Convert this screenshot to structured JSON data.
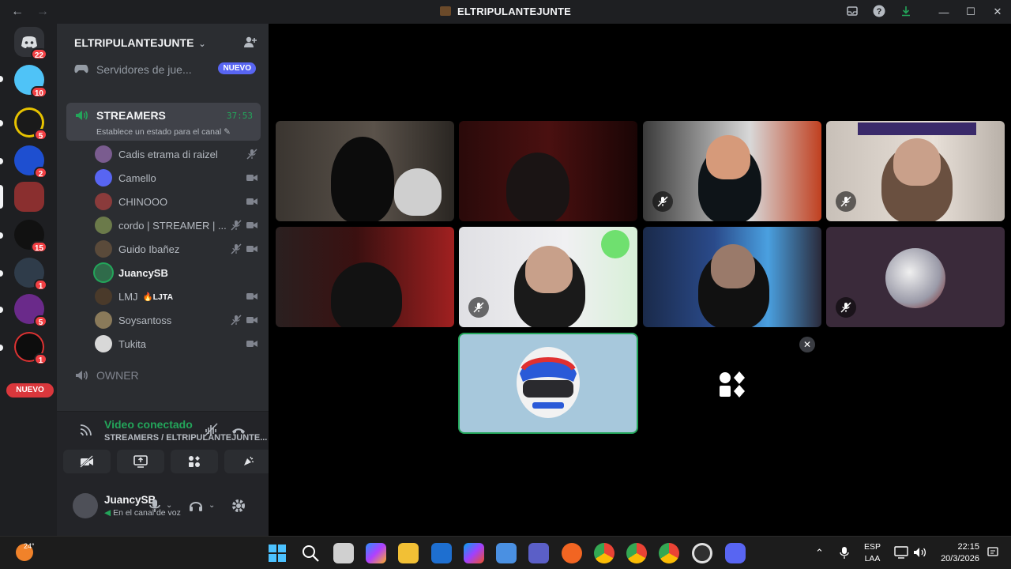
{
  "window": {
    "title": "ELTRIPULANTEJUNTE"
  },
  "rail": {
    "badges": [
      "22",
      "10",
      "5",
      "2",
      "15",
      "1",
      "5",
      "1"
    ],
    "new_label": "NUEVO"
  },
  "sidebar": {
    "server_name": "ELTRIPULANTEJUNTE",
    "games_label": "Servidores de jue...",
    "games_new_tag": "NUEVO",
    "voice_channel": {
      "name": "STREAMERS",
      "timer": "37:53",
      "status": "Establece un estado para el canal"
    },
    "members": [
      {
        "name": "Cadis etrama di raizel",
        "color": "#7a5c8f"
      },
      {
        "name": "Camello",
        "color": "#5865f2"
      },
      {
        "name": "CHINOOO",
        "color": "#8a3b3b"
      },
      {
        "name": "cordo | STREAMER | ...",
        "color": "#6b7a4a"
      },
      {
        "name": "Guido Ibañez",
        "color": "#5a4a3a"
      },
      {
        "name": "JuancySB",
        "color": "#2f6b4a"
      },
      {
        "name": "LMJ",
        "tag": "🔥LJTA",
        "color": "#4a3a2a"
      },
      {
        "name": "Soysantoss",
        "color": "#8a7a5a"
      },
      {
        "name": "Tukita",
        "color": "#d8d8d8"
      }
    ],
    "owner_channel": "OWNER",
    "rtc": {
      "status": "Video conectado",
      "channel": "STREAMERS / ELTRIPULANTEJUNTE..."
    },
    "user": {
      "name": "JuancySB",
      "status": "En el canal de voz"
    }
  },
  "taskbar": {
    "temperature": "24°",
    "lang_top": "ESP",
    "lang_bottom": "LAA",
    "time": "22:15",
    "date": "20/3/2026"
  },
  "colors": {
    "accent_green": "#23a55a",
    "brand": "#5865f2",
    "danger": "#f23f43"
  }
}
